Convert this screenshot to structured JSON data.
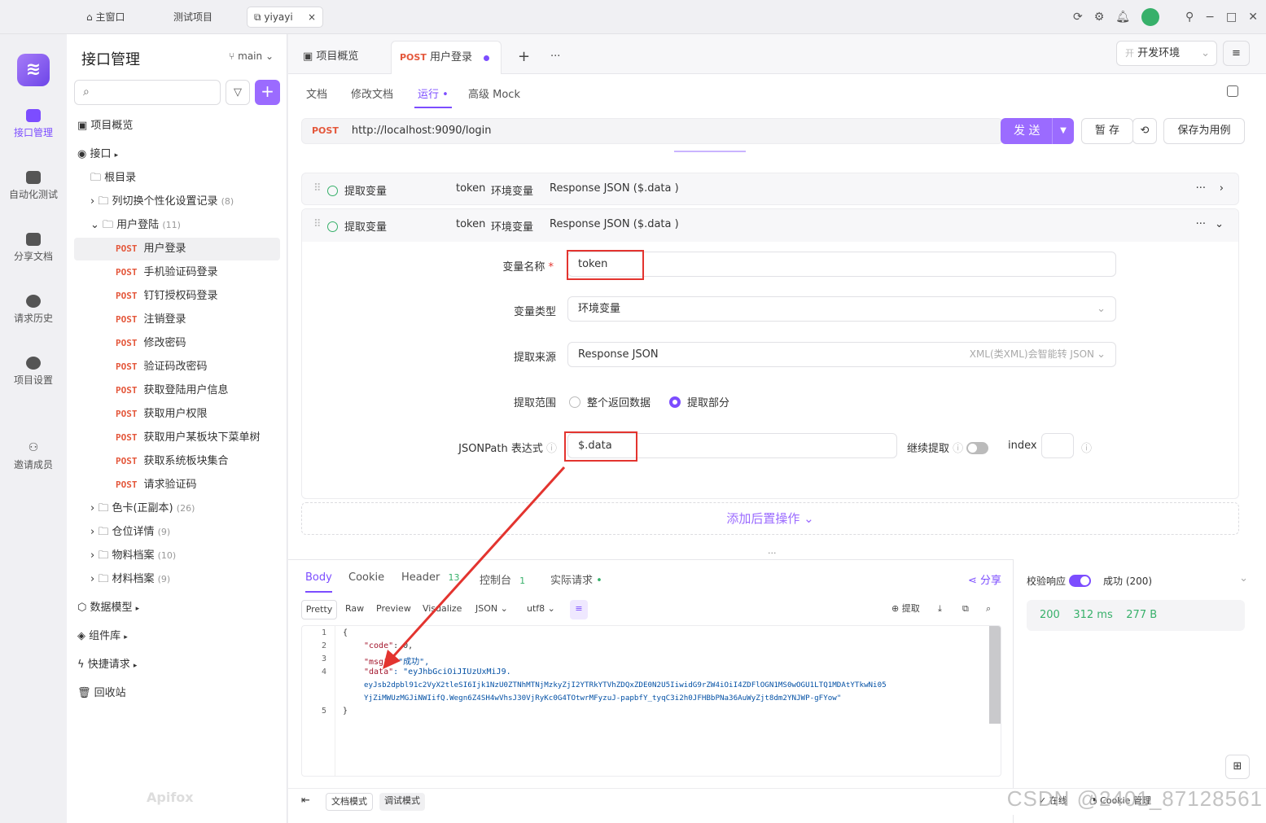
{
  "topbar": {
    "tabs": [
      {
        "label": "主窗口"
      },
      {
        "label": "测试项目"
      },
      {
        "label": "yiyayi"
      }
    ],
    "close": "×"
  },
  "rail": {
    "items": [
      {
        "label": "接口管理"
      },
      {
        "label": "自动化测试"
      },
      {
        "label": "分享文档"
      },
      {
        "label": "请求历史"
      },
      {
        "label": "项目设置"
      },
      {
        "label": "邀请成员"
      }
    ]
  },
  "sidebar": {
    "title": "接口管理",
    "branch": "main",
    "add": "+",
    "tree": [
      {
        "label": "项目概览",
        "method": "",
        "count": ""
      },
      {
        "label": "接口",
        "method": "",
        "count": ""
      },
      {
        "label": "根目录",
        "method": "",
        "count": ""
      },
      {
        "label": "列切换个性化设置记录",
        "method": "",
        "count": "(8)"
      },
      {
        "label": "用户登陆",
        "method": "",
        "count": "(11)"
      },
      {
        "label": "用户登录",
        "method": "POST",
        "count": ""
      },
      {
        "label": "手机验证码登录",
        "method": "POST",
        "count": ""
      },
      {
        "label": "钉钉授权码登录",
        "method": "POST",
        "count": ""
      },
      {
        "label": "注销登录",
        "method": "POST",
        "count": ""
      },
      {
        "label": "修改密码",
        "method": "POST",
        "count": ""
      },
      {
        "label": "验证码改密码",
        "method": "POST",
        "count": ""
      },
      {
        "label": "获取登陆用户信息",
        "method": "POST",
        "count": ""
      },
      {
        "label": "获取用户权限",
        "method": "POST",
        "count": ""
      },
      {
        "label": "获取用户某板块下菜单树",
        "method": "POST",
        "count": ""
      },
      {
        "label": "获取系统板块集合",
        "method": "POST",
        "count": ""
      },
      {
        "label": "请求验证码",
        "method": "POST",
        "count": ""
      },
      {
        "label": "色卡(正副本)",
        "method": "",
        "count": "(26)"
      },
      {
        "label": "仓位详情",
        "method": "",
        "count": "(9)"
      },
      {
        "label": "物料档案",
        "method": "",
        "count": "(10)"
      },
      {
        "label": "材料档案",
        "method": "",
        "count": "(9)"
      },
      {
        "label": "数据模型",
        "method": "",
        "count": ""
      },
      {
        "label": "组件库",
        "method": "",
        "count": ""
      },
      {
        "label": "快捷请求",
        "method": "",
        "count": ""
      },
      {
        "label": "回收站",
        "method": "",
        "count": ""
      }
    ],
    "footer_logo": "Apifox"
  },
  "main": {
    "tabs": [
      {
        "label": "项目概览"
      },
      {
        "method": "POST",
        "label": "用户登录"
      }
    ],
    "env": "开发环境",
    "env_badge": "开",
    "subtabs": [
      "文档",
      "修改文档",
      "运行",
      "高级 Mock"
    ],
    "url_method": "POST",
    "url": "http://localhost:9090/login",
    "send": "发 送",
    "save_temp": "暂 存",
    "save_case": "保存为用例",
    "extract_rows": [
      {
        "title": "提取变量",
        "var": "token",
        "type": "环境变量",
        "source": "Response JSON ($.data )"
      },
      {
        "title": "提取变量",
        "var": "token",
        "type": "环境变量",
        "source": "Response JSON ($.data )"
      }
    ],
    "form": {
      "name_label": "变量名称",
      "name_value": "token",
      "type_label": "变量类型",
      "type_value": "环境变量",
      "source_label": "提取来源",
      "source_value": "Response JSON",
      "source_hint": "XML(类XML)会智能转 JSON",
      "range_label": "提取范围",
      "range_opt1": "整个返回数据",
      "range_opt2": "提取部分",
      "jsonpath_label": "JSONPath 表达式",
      "jsonpath_value": "$.data",
      "continue_label": "继续提取",
      "index_label": "index"
    },
    "add_after": "添加后置操作"
  },
  "response": {
    "tabs": [
      "Body",
      "Cookie",
      "Header",
      "控制台",
      "实际请求"
    ],
    "header_count": "13",
    "console_count": "1",
    "share": "分享",
    "views": [
      "Pretty",
      "Raw",
      "Preview",
      "Visualize",
      "JSON",
      "utf8"
    ],
    "extract": "提取",
    "code_lines": [
      {
        "n": "1",
        "text": "{"
      },
      {
        "n": "2",
        "key": "\"code\"",
        "val": ": 0,"
      },
      {
        "n": "3",
        "key": "\"msg\"",
        "val": ": \"成功\","
      },
      {
        "n": "4",
        "key": "\"data\"",
        "val": ": \"eyJhbGciOiJIUzUxMiJ9."
      },
      {
        "n": "",
        "text": "eyJsb2dpbl91c2VyX2tleSI6Ijk1NzU0ZTNhMTNjMzkyZjI2YTRkYTVhZDQxZDE0N2U5IiwidG9rZW4iOiI4ZDFlOGN1MS0wOGU1LTQ1MDAtYTkwNi05"
      },
      {
        "n": "",
        "text": "YjZiMWUzMGJiNWIifQ.Wegn6Z4SH4wVhsJ30VjRyKc0G4TOtwrMFyzuJ-papbfY_tyqC3i2h0JFHBbPNa36AuWyZjt8dm2YNJWP-gFYow\""
      },
      {
        "n": "5",
        "text": "}"
      }
    ],
    "validate": "校验响应",
    "result": "成功 (200)",
    "status": "200",
    "time": "312 ms",
    "size": "277 B"
  },
  "bottombar": {
    "doc_mode": "文档模式",
    "debug_mode": "调试模式",
    "online": "在线",
    "cookie": "Cookie 管理"
  },
  "watermark": "CSDN @2401_87128561",
  "colors": {
    "accent": "#7c4dff",
    "post": "#e4573b",
    "success": "#37b06a",
    "annotation": "#e3342f"
  }
}
